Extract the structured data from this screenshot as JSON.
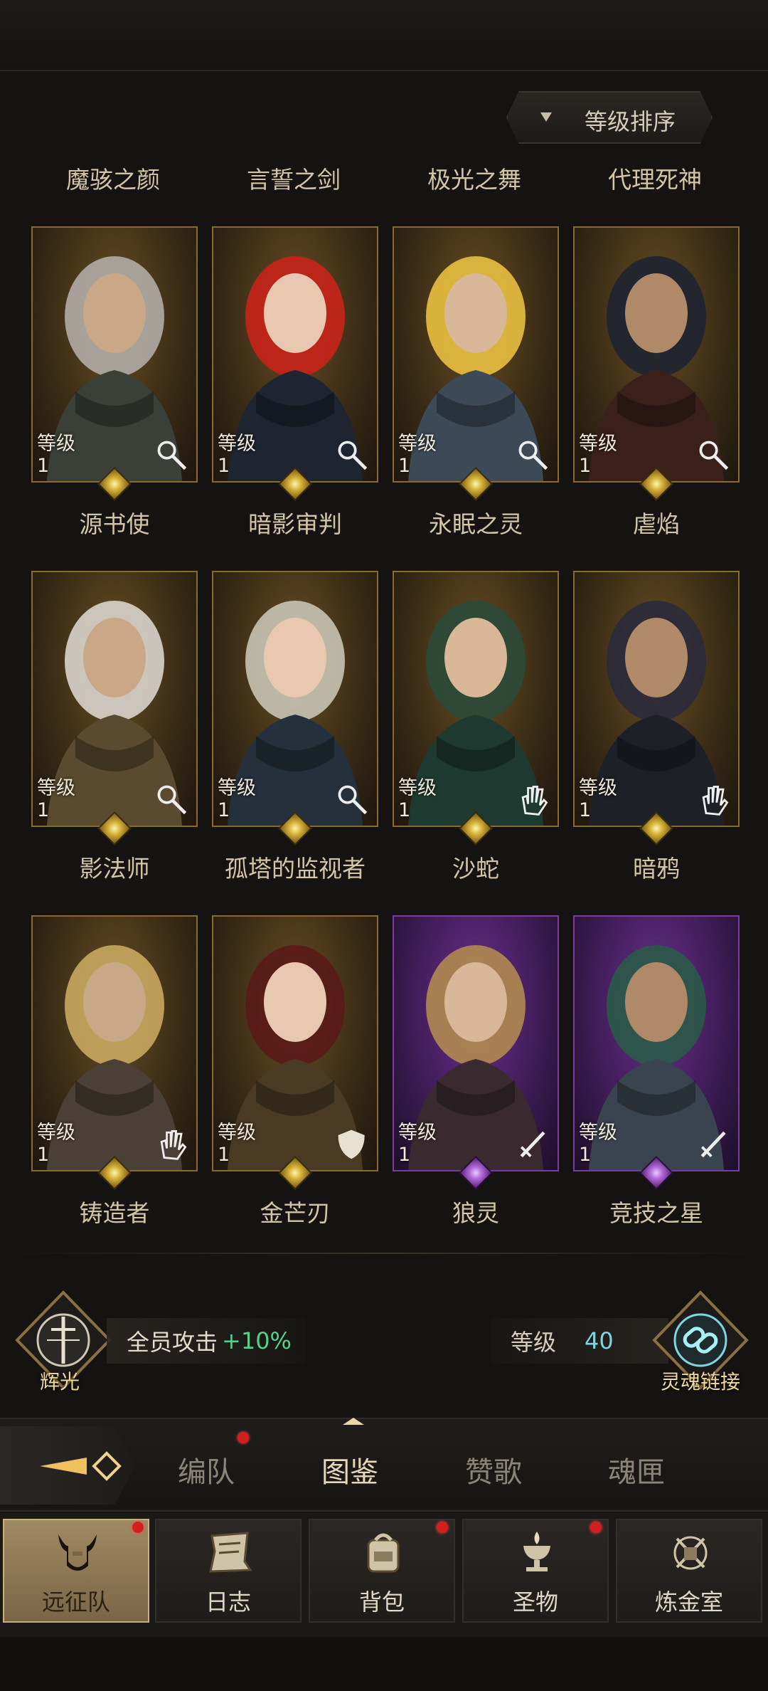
{
  "sort_button": {
    "label": "等级排序",
    "icon": "caret-down-icon"
  },
  "top_names": [
    "魔骇之颜",
    "言誓之剑",
    "极光之舞",
    "代理死神"
  ],
  "level_label": "等级",
  "heroes": [
    {
      "name": "源书使",
      "level": "1",
      "class_icon": "staff-icon",
      "rarity": "gold"
    },
    {
      "name": "暗影审判",
      "level": "1",
      "class_icon": "staff-icon",
      "rarity": "gold"
    },
    {
      "name": "永眠之灵",
      "level": "1",
      "class_icon": "staff-icon",
      "rarity": "gold"
    },
    {
      "name": "虐焰",
      "level": "1",
      "class_icon": "staff-icon",
      "rarity": "gold"
    },
    {
      "name": "影法师",
      "level": "1",
      "class_icon": "staff-icon",
      "rarity": "gold"
    },
    {
      "name": "孤塔的监视者",
      "level": "1",
      "class_icon": "staff-icon",
      "rarity": "gold"
    },
    {
      "name": "沙蛇",
      "level": "1",
      "class_icon": "hand-icon",
      "rarity": "gold"
    },
    {
      "name": "暗鸦",
      "level": "1",
      "class_icon": "hand-icon",
      "rarity": "gold"
    },
    {
      "name": "铸造者",
      "level": "1",
      "class_icon": "hand-icon",
      "rarity": "gold"
    },
    {
      "name": "金芒刃",
      "level": "1",
      "class_icon": "shield-icon",
      "rarity": "gold"
    },
    {
      "name": "狼灵",
      "level": "1",
      "class_icon": "sword-icon",
      "rarity": "purple"
    },
    {
      "name": "竞技之星",
      "level": "1",
      "class_icon": "sword-icon",
      "rarity": "purple"
    }
  ],
  "radiance": {
    "label": "辉光",
    "bonus_text": "全员攻击",
    "bonus_value": "+10%"
  },
  "soul_link": {
    "label": "灵魂链接",
    "level_label": "等级",
    "level_value": "40"
  },
  "tabs": [
    {
      "label": "编队",
      "badge": true
    },
    {
      "label": "图鉴",
      "active": true
    },
    {
      "label": "赞歌"
    },
    {
      "label": "魂匣"
    }
  ],
  "nav": [
    {
      "label": "远征队",
      "icon": "helmet-icon",
      "active": true,
      "badge": true
    },
    {
      "label": "日志",
      "icon": "scroll-icon"
    },
    {
      "label": "背包",
      "icon": "backpack-icon",
      "badge": true
    },
    {
      "label": "圣物",
      "icon": "chalice-icon",
      "badge": true
    },
    {
      "label": "炼金室",
      "icon": "alchemy-icon"
    }
  ],
  "colors": {
    "gold_frame": "#8a6a2a",
    "purple_frame": "#7a3ca0",
    "accent_green": "#56d08a",
    "level_cyan": "#7ed6e0",
    "badge_red": "#d41f1f"
  }
}
